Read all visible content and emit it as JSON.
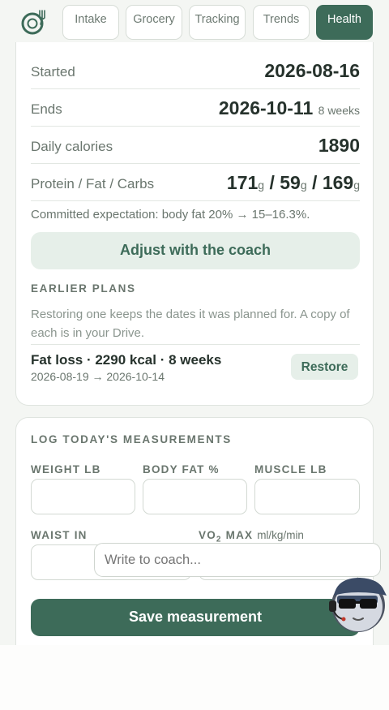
{
  "nav": {
    "tabs": [
      {
        "label": "Intake",
        "active": false
      },
      {
        "label": "Grocery",
        "active": false
      },
      {
        "label": "Tracking",
        "active": false
      },
      {
        "label": "Trends",
        "active": false
      },
      {
        "label": "Health",
        "active": true
      }
    ]
  },
  "plan": {
    "started_label": "Started",
    "started_value": "2026-08-16",
    "ends_label": "Ends",
    "ends_value": "2026-10-11",
    "ends_duration": "8 weeks",
    "calories_label": "Daily calories",
    "calories_value": "1890",
    "macros_label": "Protein / Fat / Carbs",
    "protein": "171",
    "fat": "59",
    "carbs": "169",
    "macro_unit": "g",
    "macro_sep": " / ",
    "commitment": "Committed expectation: body fat 20% → 15–16.3%.",
    "adjust_label": "Adjust with the coach"
  },
  "earlier": {
    "heading": "EARLIER PLANS",
    "note": "Restoring one keeps the dates it was planned for. A copy of each is in your Drive.",
    "items": [
      {
        "title": "Fat loss · 2290 kcal · 8 weeks",
        "dates": "2026-08-19 → 2026-10-14",
        "action": "Restore"
      }
    ]
  },
  "measure": {
    "heading": "LOG TODAY'S MEASUREMENTS",
    "weight_label": "WEIGHT LB",
    "bodyfat_label": "BODY FAT %",
    "muscle_label": "MUSCLE LB",
    "waist_label": "WAIST IN",
    "vo2_label_a": "VO",
    "vo2_label_sub": "2",
    "vo2_label_b": " MAX",
    "vo2_unit": "ml/kg/min",
    "save_label": "Save measurement"
  },
  "coach": {
    "placeholder": "Write to coach..."
  },
  "colors": {
    "accent": "#3d6b59",
    "accent_light": "#e6efe9",
    "background": "#f4f6f3"
  }
}
